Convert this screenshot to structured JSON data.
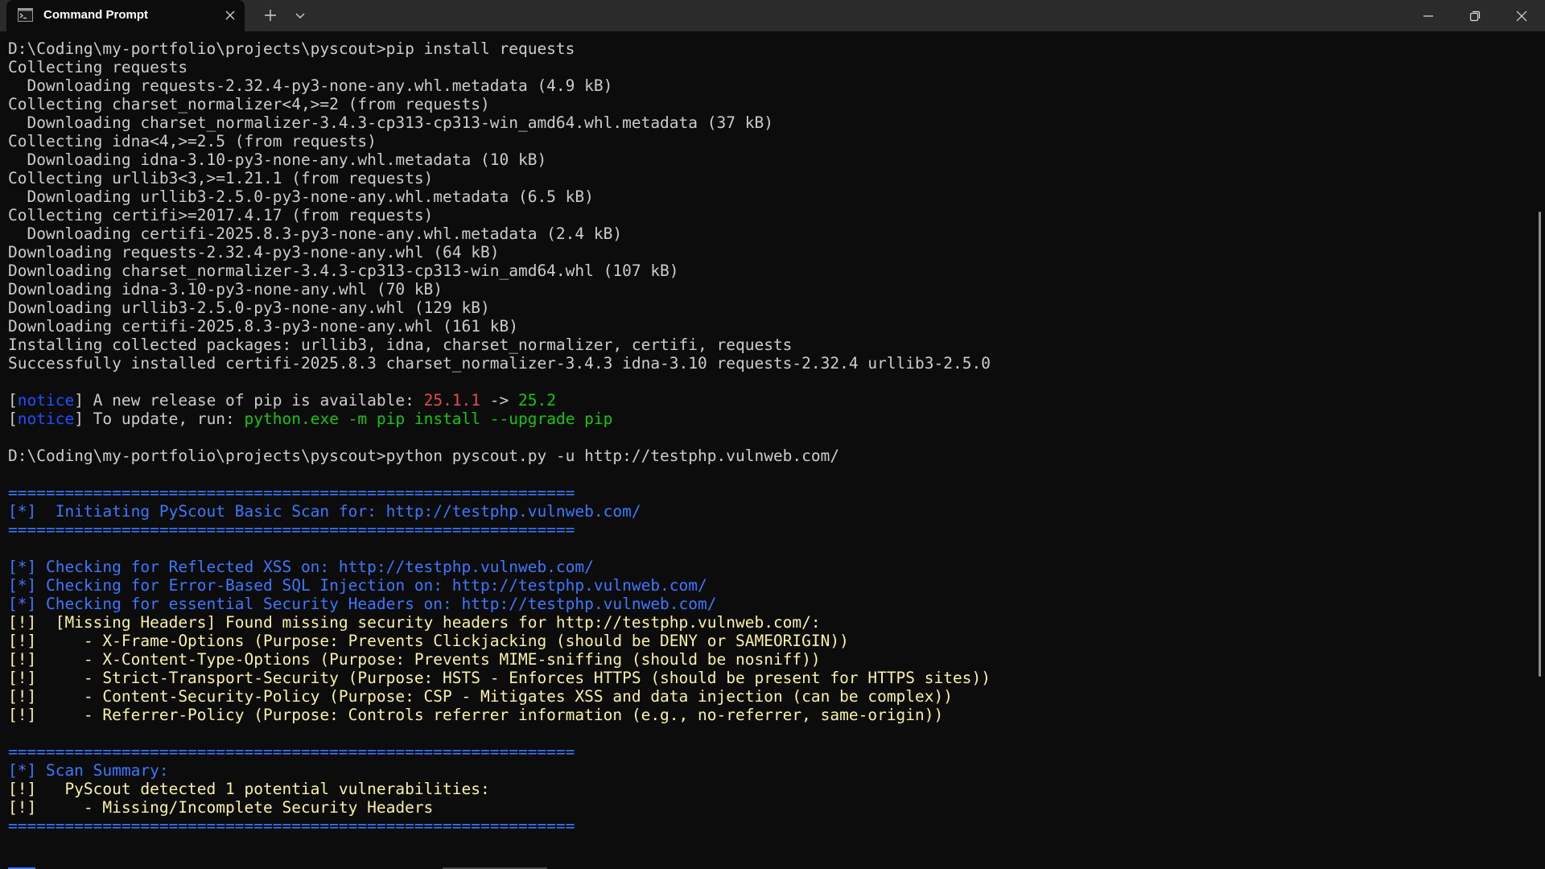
{
  "window": {
    "tab_title": "Command Prompt",
    "tab_icon": "cmd-icon",
    "controls": [
      "new-tab-icon",
      "tab-menu-chevron-icon",
      "minimize-icon",
      "maximize-icon",
      "close-icon"
    ]
  },
  "colors": {
    "background": "#0c0c0c",
    "text": "#cccccc",
    "blue": "#3b78ff",
    "yellow": "#f9f1a5",
    "red": "#e74856",
    "green": "#16c60c"
  },
  "console": {
    "lines": [
      "D:\\Coding\\my-portfolio\\projects\\pyscout>pip install requests",
      "Collecting requests",
      "  Downloading requests-2.32.4-py3-none-any.whl.metadata (4.9 kB)",
      "Collecting charset_normalizer<4,>=2 (from requests)",
      "  Downloading charset_normalizer-3.4.3-cp313-cp313-win_amd64.whl.metadata (37 kB)",
      "Collecting idna<4,>=2.5 (from requests)",
      "  Downloading idna-3.10-py3-none-any.whl.metadata (10 kB)",
      "Collecting urllib3<3,>=1.21.1 (from requests)",
      "  Downloading urllib3-2.5.0-py3-none-any.whl.metadata (6.5 kB)",
      "Collecting certifi>=2017.4.17 (from requests)",
      "  Downloading certifi-2025.8.3-py3-none-any.whl.metadata (2.4 kB)",
      "Downloading requests-2.32.4-py3-none-any.whl (64 kB)",
      "Downloading charset_normalizer-3.4.3-cp313-cp313-win_amd64.whl (107 kB)",
      "Downloading idna-3.10-py3-none-any.whl (70 kB)",
      "Downloading urllib3-2.5.0-py3-none-any.whl (129 kB)",
      "Downloading certifi-2025.8.3-py3-none-any.whl (161 kB)",
      "Installing collected packages: urllib3, idna, charset_normalizer, certifi, requests",
      "Successfully installed certifi-2025.8.3 charset_normalizer-3.4.3 idna-3.10 requests-2.32.4 urllib3-2.5.0",
      "",
      "",
      "",
      "",
      "D:\\Coding\\my-portfolio\\projects\\pyscout>python pyscout.py -u http://testphp.vulnweb.com/",
      "",
      "============================================================",
      "[*]  Initiating PyScout Basic Scan for: http://testphp.vulnweb.com/",
      "============================================================",
      "",
      "[*] Checking for Reflected XSS on: http://testphp.vulnweb.com/",
      "[*] Checking for Error-Based SQL Injection on: http://testphp.vulnweb.com/",
      "[*] Checking for essential Security Headers on: http://testphp.vulnweb.com/",
      "[!]  [Missing Headers] Found missing security headers for http://testphp.vulnweb.com/:",
      "[!]     - X-Frame-Options (Purpose: Prevents Clickjacking (should be DENY or SAMEORIGIN))",
      "[!]     - X-Content-Type-Options (Purpose: Prevents MIME-sniffing (should be nosniff))",
      "[!]     - Strict-Transport-Security (Purpose: HSTS - Enforces HTTPS (should be present for HTTPS sites))",
      "[!]     - Content-Security-Policy (Purpose: CSP - Mitigates XSS and data injection (can be complex))",
      "[!]     - Referrer-Policy (Purpose: Controls referrer information (e.g., no-referrer, same-origin))",
      "",
      "============================================================",
      "[*] Scan Summary:",
      "[!]   PyScout detected 1 potential vulnerabilities:",
      "[!]     - Missing/Incomplete Security Headers",
      "============================================================"
    ],
    "notice1": {
      "open": "[",
      "tag": "notice",
      "mid": "] A new release of pip is available: ",
      "old_version": "25.1.1",
      "arrow": " -> ",
      "new_version": "25.2"
    },
    "notice2": {
      "open": "[",
      "tag": "notice",
      "mid": "] To update, run: ",
      "command": "python.exe -m pip install --upgrade pip"
    }
  }
}
